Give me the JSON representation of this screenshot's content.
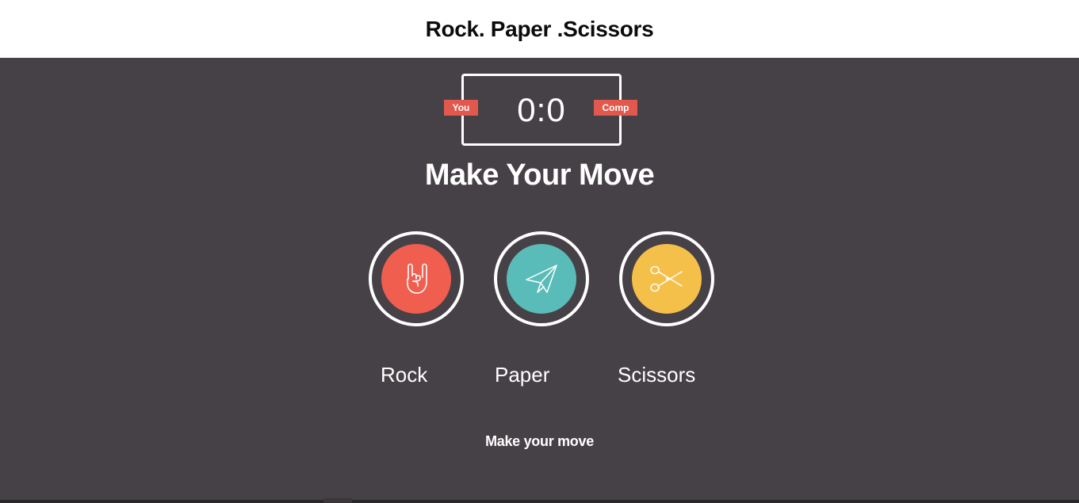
{
  "header": {
    "title": "Rock. Paper .Scissors"
  },
  "scoreboard": {
    "user_label": "You",
    "user_score": "0",
    "separator": ":",
    "comp_label": "Comp",
    "comp_score": "0"
  },
  "heading": "Make Your Move",
  "choices": [
    {
      "label": "Rock",
      "color": "#ef5e4e",
      "icon": "rock-hand-icon"
    },
    {
      "label": "Paper",
      "color": "#5abcb9",
      "icon": "paper-plane-icon"
    },
    {
      "label": "Scissors",
      "color": "#f5c04a",
      "icon": "scissors-icon"
    }
  ],
  "message": "Make your move",
  "colors": {
    "background": "#464146",
    "header_background": "#ffffff",
    "badge": "#e2584d"
  }
}
